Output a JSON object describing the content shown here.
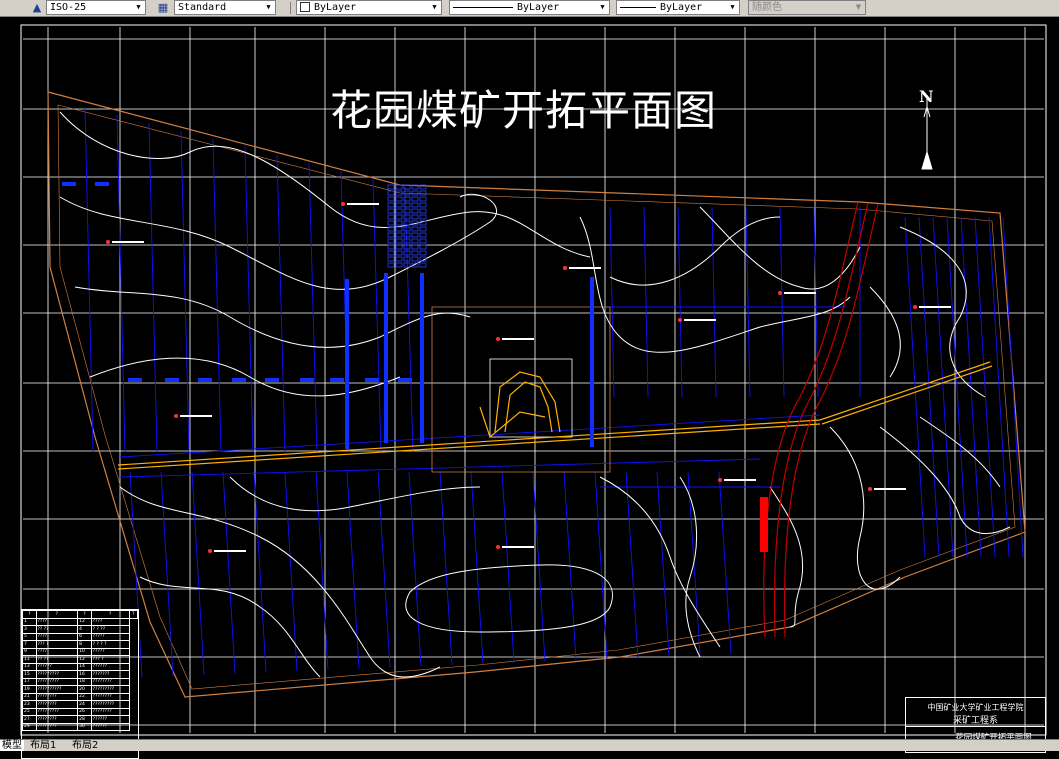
{
  "toolbar": {
    "dimstyle": "ISO-25",
    "textstyle": "Standard",
    "layer": "ByLayer",
    "linetype": "ByLayer",
    "lineweight": "ByLayer",
    "plotstyle": "随颜色"
  },
  "drawing": {
    "title": "花园煤矿开拓平面图",
    "north_label": "N"
  },
  "title_block": {
    "school": "中国矿业大学矿业工程学院",
    "department": "采矿工程系",
    "drawing_name": "花园煤矿开拓平面图"
  },
  "legend": {
    "header": [
      "?",
      "?",
      "?",
      "?",
      "?"
    ],
    "rows": [
      [
        "1",
        "????",
        "12",
        "????"
      ],
      [
        "3",
        "?? ??",
        "4",
        "? ? ??"
      ],
      [
        "5",
        "????",
        "6",
        "?????"
      ],
      [
        "7",
        "??? ?",
        "8",
        "? ? ? ?"
      ],
      [
        "9",
        "????",
        "10",
        "?????"
      ],
      [
        "11",
        "?? ??",
        "12",
        "??? ?"
      ],
      [
        "13",
        "??????",
        "14",
        "??????"
      ],
      [
        "15",
        "?????????",
        "16",
        "???????"
      ],
      [
        "17",
        "?????????",
        "18",
        "????????"
      ],
      [
        "19",
        "??????????",
        "20",
        "?????????"
      ],
      [
        "21",
        "????????",
        "22",
        "????????"
      ],
      [
        "23",
        "????????",
        "24",
        "?????????"
      ],
      [
        "25",
        "?????????",
        "26",
        "????????"
      ],
      [
        "27",
        "????????",
        "28",
        "??????"
      ],
      [
        "29",
        "????????",
        "30",
        "??????"
      ]
    ]
  },
  "tabs": [
    "模型",
    "布局1",
    "布局2"
  ],
  "colors": {
    "boundary": "#d08040",
    "grid": "#ffffff",
    "blocks": "#0000ff",
    "roadway": "#ffb000",
    "fault": "#c00000"
  }
}
